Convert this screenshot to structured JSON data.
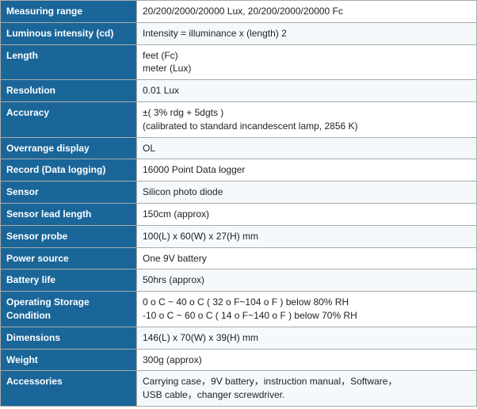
{
  "rows": [
    {
      "label": "Measuring range",
      "value": "20/200/2000/20000 Lux, 20/200/2000/20000 Fc"
    },
    {
      "label": "Luminous intensity (cd)",
      "value": "Intensity = illuminance x (length) 2"
    },
    {
      "label": "Length",
      "value": "feet (Fc)\nmeter (Lux)"
    },
    {
      "label": "Resolution",
      "value": "0.01 Lux"
    },
    {
      "label": "Accuracy",
      "value": "±( 3% rdg + 5dgts )\n(calibrated to standard incandescent lamp, 2856 K)"
    },
    {
      "label": "Overrange display",
      "value": "OL"
    },
    {
      "label": "Record (Data logging)",
      "value": "16000 Point Data logger"
    },
    {
      "label": "Sensor",
      "value": "Silicon photo diode"
    },
    {
      "label": "Sensor lead length",
      "value": "150cm (approx)"
    },
    {
      "label": "Sensor probe",
      "value": "100(L) x 60(W) x 27(H) mm"
    },
    {
      "label": "Power source",
      "value": "One 9V battery"
    },
    {
      "label": "Battery life",
      "value": "50hrs (approx)"
    },
    {
      "label": "Operating Storage Condition",
      "value": "0 o C ~ 40 o C ( 32 o F~104 o F ) below 80% RH\n-10 o C ~ 60 o C ( 14 o F~140 o F ) below 70% RH"
    },
    {
      "label": "Dimensions",
      "value": "146(L) x 70(W) x 39(H) mm"
    },
    {
      "label": "Weight",
      "value": "300g (approx)"
    },
    {
      "label": "Accessories",
      "value": "Carrying case，9V battery，instruction manual，Software，\nUSB cable，changer screwdriver."
    }
  ]
}
